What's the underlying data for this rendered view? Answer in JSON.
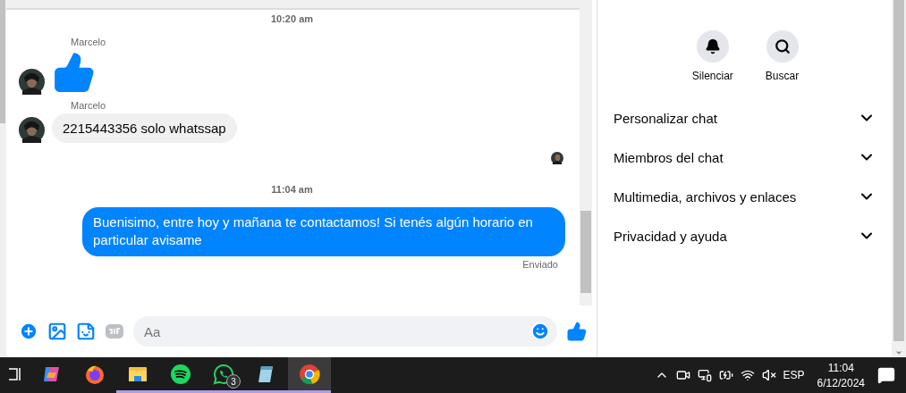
{
  "chat": {
    "messages": [
      {
        "kind": "timestamp",
        "text": "10:20 am"
      },
      {
        "kind": "like",
        "sender": "Marcelo"
      },
      {
        "kind": "text",
        "sender": "Marcelo",
        "text": "2215443356 solo whatssap"
      },
      {
        "kind": "seen"
      },
      {
        "kind": "timestamp",
        "text": "11:04 am"
      },
      {
        "kind": "outgoing",
        "text": "Buenisimo, entre hoy y mañana te contactamos! Si tenés algún horario en particular avisame",
        "status": "Enviado"
      }
    ]
  },
  "composer": {
    "placeholder": "Aa"
  },
  "details": {
    "actions": [
      {
        "kind": "bell",
        "label": "Silenciar"
      },
      {
        "kind": "search",
        "label": "Buscar"
      }
    ],
    "sections": [
      {
        "label": "Personalizar chat",
        "expanded": false
      },
      {
        "label": "Miembros del chat",
        "expanded": false
      },
      {
        "label": "Multimedia, archivos y enlaces",
        "expanded": false
      },
      {
        "label": "Privacidad y ayuda",
        "expanded": false
      }
    ]
  },
  "taskbar": {
    "apps": [
      {
        "kind": "copilot",
        "running": false,
        "active": false
      },
      {
        "kind": "firefox",
        "running": false,
        "active": false
      },
      {
        "kind": "folder",
        "running": true,
        "active": false
      },
      {
        "kind": "spotify",
        "running": true,
        "active": false
      },
      {
        "kind": "whatsapp",
        "running": true,
        "active": false,
        "badge": "3"
      },
      {
        "kind": "notepad",
        "running": true,
        "active": false
      },
      {
        "kind": "chrome",
        "running": true,
        "active": true
      }
    ],
    "language": "ESP",
    "time": "11:04",
    "date": "6/12/2024"
  }
}
